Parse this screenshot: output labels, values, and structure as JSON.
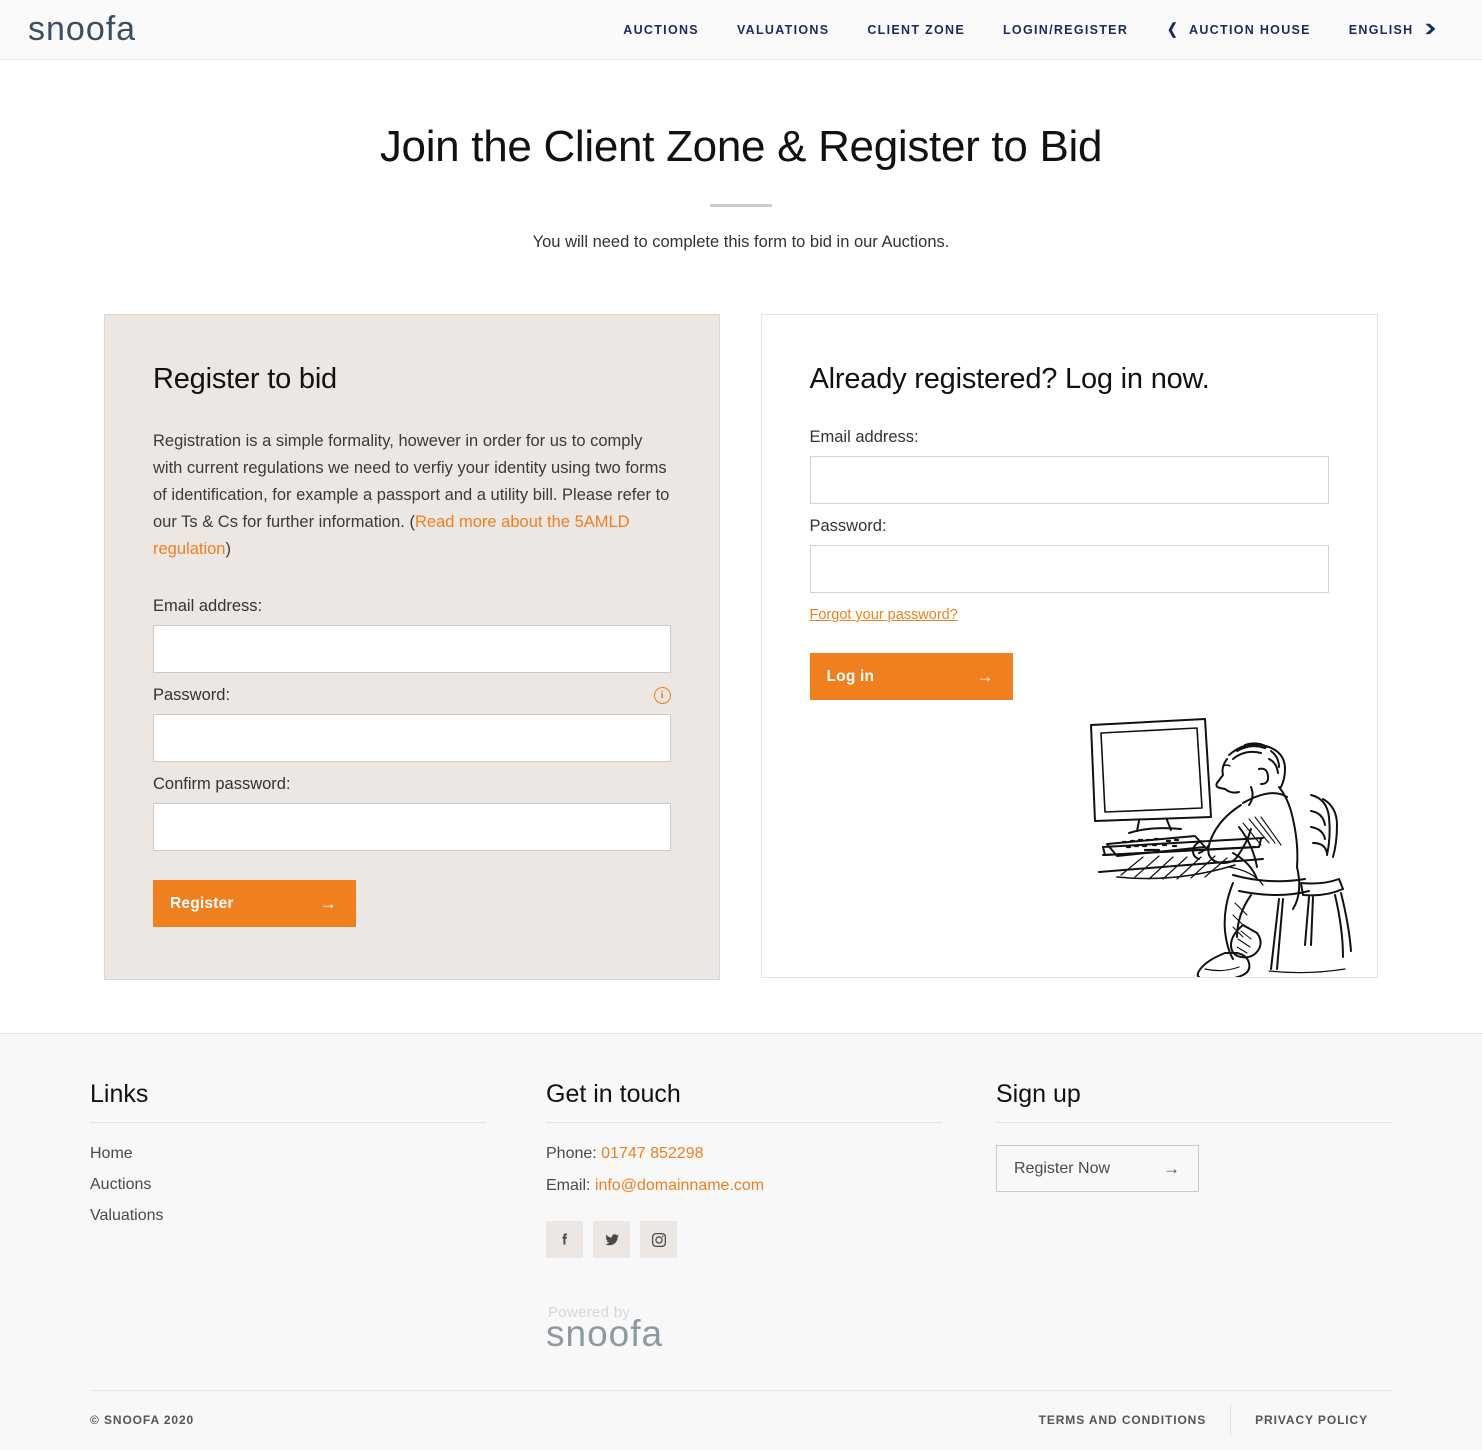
{
  "header": {
    "logo": "snoofa",
    "nav": [
      {
        "label": "AUCTIONS",
        "icon": null
      },
      {
        "label": "VALUATIONS",
        "icon": null
      },
      {
        "label": "CLIENT ZONE",
        "icon": null
      },
      {
        "label": "LOGIN/REGISTER",
        "icon": null
      },
      {
        "label": "AUCTION HOUSE",
        "icon": "chevron-left-icon"
      },
      {
        "label": "ENGLISH",
        "icon": "chevron-down-icon"
      }
    ]
  },
  "hero": {
    "title": "Join the Client Zone & Register to Bid",
    "subtitle": "You will need to complete this form to bid in our Auctions."
  },
  "register_panel": {
    "title": "Register to bid",
    "body": "Registration is a simple formality, however in order for us to comply with current regulations we need to verfiy your identity using two forms of identification, for example a passport and a utility bill. Please refer to our Ts & Cs for further information. ",
    "link_open": "(",
    "link_text": "Read more about the 5AMLD regulation",
    "link_close": ")",
    "email_label": "Email address:",
    "email_value": "",
    "password_label": "Password:",
    "password_value": "",
    "info_icon": "i",
    "confirm_label": "Confirm password:",
    "confirm_value": "",
    "submit_label": "Register",
    "arrow": "→"
  },
  "login_panel": {
    "title": "Already registered? Log in now.",
    "email_label": "Email address:",
    "email_value": "",
    "password_label": "Password:",
    "password_value": "",
    "forgot_label": "Forgot your password?",
    "submit_label": "Log in",
    "arrow": "→"
  },
  "footer": {
    "links": {
      "heading": "Links",
      "items": [
        "Home",
        "Auctions",
        "Valuations"
      ]
    },
    "contact": {
      "heading": "Get in touch",
      "phone_label": "Phone: ",
      "phone_value": "01747 852298",
      "email_label": "Email: ",
      "email_value": "info@domainname.com",
      "socials": [
        "facebook-icon",
        "twitter-icon",
        "instagram-icon"
      ]
    },
    "signup": {
      "heading": "Sign up",
      "button_label": "Register Now",
      "arrow": "→"
    },
    "powered": {
      "label": "Powered by",
      "logo": "snoofa"
    },
    "bottom": {
      "copyright": "© SNOOFA 2020",
      "terms": "TERMS AND CONDITIONS",
      "privacy": "PRIVACY POLICY"
    }
  },
  "colors": {
    "orange": "#ef7f1f",
    "navy": "#1b2a5e",
    "panel_bg": "#ece7e3",
    "logo_slate": "#3c4f5e"
  }
}
